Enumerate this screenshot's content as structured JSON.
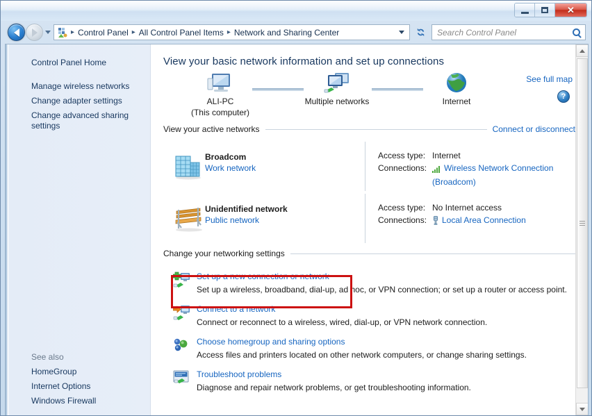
{
  "window": {
    "controls": {
      "minimize": "Minimize",
      "maximize": "Maximize",
      "close": "✕"
    }
  },
  "addressbar": {
    "back_label": "Back",
    "forward_label": "Forward",
    "history_label": "Recent pages",
    "breadcrumbs": [
      "Control Panel",
      "All Control Panel Items",
      "Network and Sharing Center"
    ],
    "separator": "▸",
    "refresh_label": "Refresh",
    "search": {
      "placeholder": "Search Control Panel",
      "value": ""
    }
  },
  "sidebar": {
    "items": [
      {
        "label": "Control Panel Home"
      },
      {
        "label": "Manage wireless networks"
      },
      {
        "label": "Change adapter settings"
      },
      {
        "label": "Change advanced sharing settings"
      }
    ],
    "see_also": {
      "title": "See also",
      "items": [
        {
          "label": "HomeGroup"
        },
        {
          "label": "Internet Options"
        },
        {
          "label": "Windows Firewall"
        }
      ]
    }
  },
  "content": {
    "heading": "View your basic network information and set up connections",
    "help_label": "?",
    "map": {
      "see_full_map": "See full map",
      "nodes": [
        {
          "label": "ALI-PC",
          "sublabel": "(This computer)",
          "icon": "computer-icon"
        },
        {
          "label": "Multiple networks",
          "sublabel": "",
          "icon": "multiple-networks-icon"
        },
        {
          "label": "Internet",
          "sublabel": "",
          "icon": "globe-icon"
        }
      ]
    },
    "active_networks": {
      "title": "View your active networks",
      "action_link": "Connect or disconnect",
      "rows": [
        {
          "icon": "office-building-icon",
          "name": "Broadcom",
          "type": "Work network",
          "access_type_label": "Access type:",
          "access_type_value": "Internet",
          "connections_label": "Connections:",
          "connection_icon": "wireless-signal-icon",
          "connection_name": "Wireless Network Connection",
          "connection_sub": "(Broadcom)"
        },
        {
          "icon": "park-bench-icon",
          "name": "Unidentified network",
          "type": "Public network",
          "access_type_label": "Access type:",
          "access_type_value": "No Internet access",
          "connections_label": "Connections:",
          "connection_icon": "ethernet-plug-icon",
          "connection_name": "Local Area Connection",
          "connection_sub": ""
        }
      ]
    },
    "change_settings": {
      "title": "Change your networking settings",
      "tasks": [
        {
          "icon": "new-connection-icon",
          "title": "Set up a new connection or network",
          "desc": "Set up a wireless, broadband, dial-up, ad hoc, or VPN connection; or set up a router or access point.",
          "highlighted": true
        },
        {
          "icon": "connect-network-icon",
          "title": "Connect to a network",
          "desc": "Connect or reconnect to a wireless, wired, dial-up, or VPN network connection.",
          "highlighted": false
        },
        {
          "icon": "homegroup-icon",
          "title": "Choose homegroup and sharing options",
          "desc": "Access files and printers located on other network computers, or change sharing settings.",
          "highlighted": false
        },
        {
          "icon": "troubleshoot-icon",
          "title": "Troubleshoot problems",
          "desc": "Diagnose and repair network problems, or get troubleshooting information.",
          "highlighted": false
        }
      ]
    }
  },
  "colors": {
    "link": "#1665c0",
    "heading": "#17375e",
    "highlight_box": "#cc1111",
    "sidebar_bg": "#e4ecf7",
    "close_button": "#c22d1c"
  }
}
